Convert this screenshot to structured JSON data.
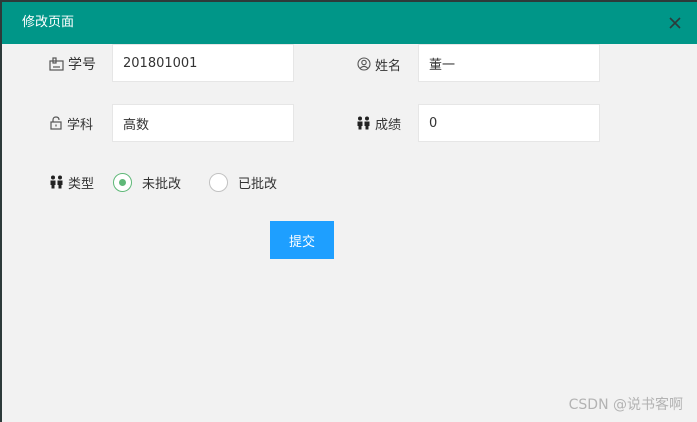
{
  "dialog": {
    "title": "修改页面"
  },
  "form": {
    "student_id": {
      "label": "学号",
      "value": "201801001"
    },
    "name": {
      "label": "姓名",
      "value": "董一"
    },
    "subject": {
      "label": "学科",
      "value": "高数"
    },
    "score": {
      "label": "成绩",
      "value": "0"
    },
    "type": {
      "label": "类型",
      "options": [
        {
          "label": "未批改",
          "checked": true
        },
        {
          "label": "已批改",
          "checked": false
        }
      ]
    },
    "submit_label": "提交"
  },
  "watermark": "CSDN @说书客啊",
  "colors": {
    "titlebar": "#009688",
    "button": "#1e9fff",
    "radio_checked": "#5fb878",
    "background": "#f2f2f2"
  },
  "icons": [
    "close-icon",
    "id-card-icon",
    "user-circle-icon",
    "lock-icon",
    "people-icon"
  ]
}
